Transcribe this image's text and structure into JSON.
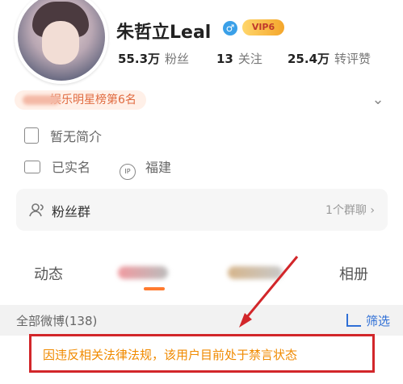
{
  "profile": {
    "name": "朱哲立Leal",
    "gender_icon": "male-icon",
    "vip_badge": "VIP6",
    "stats": [
      {
        "num": "55.3万",
        "label": "粉丝"
      },
      {
        "num": "13",
        "label": "关注"
      },
      {
        "num": "25.4万",
        "label": "转评赞"
      }
    ]
  },
  "rank": {
    "text": "娱乐明星榜第6名"
  },
  "info": {
    "intro": "暂无简介",
    "verified": "已实名",
    "ip_location": "福建",
    "ip_icon_text": "IP"
  },
  "fans_group": {
    "title": "粉丝群",
    "right_text": "1个群聊 ›"
  },
  "tabs": {
    "dynamics": "动态",
    "album": "相册"
  },
  "feed": {
    "all_weibo": "全部微博(138)",
    "filter": "筛选"
  },
  "notice": {
    "ban_text": "因违反相关法律法规，该用户目前处于禁言状态"
  },
  "colors": {
    "accent_orange": "#ff7a2e",
    "link_blue": "#2f6fd6",
    "warning_orange": "#f08a00",
    "highlight_red": "#d2262a"
  }
}
